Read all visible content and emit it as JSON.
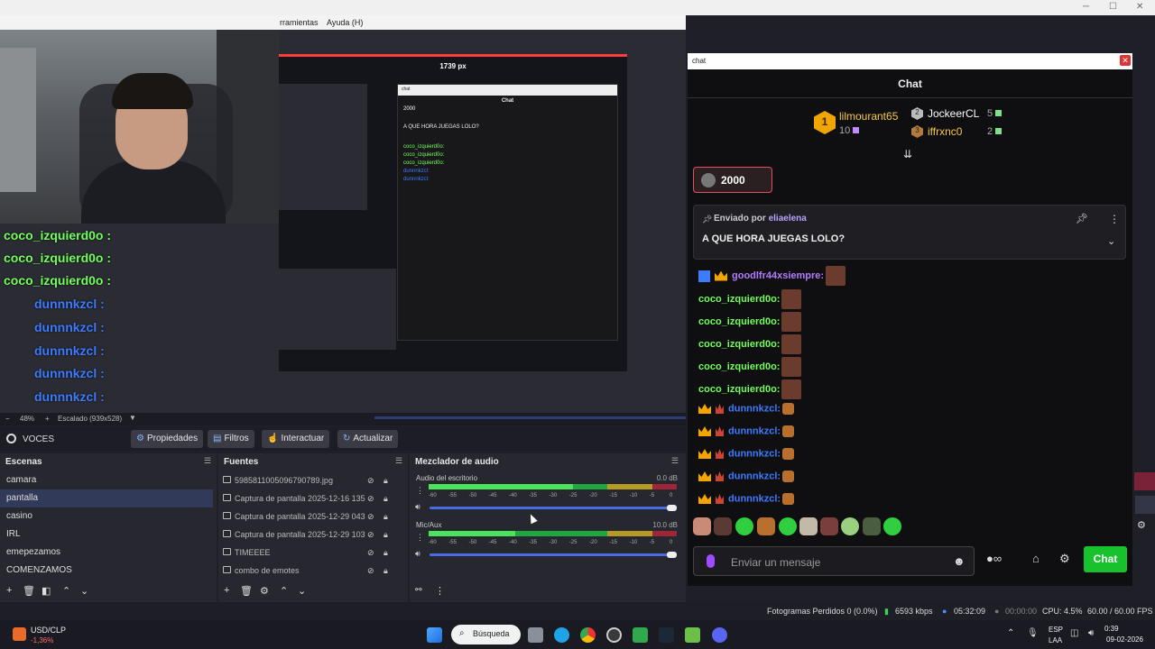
{
  "obs": {
    "menu": [
      {
        "label": "rramientas"
      },
      {
        "label": "Ayuda (H)"
      }
    ],
    "preview": {
      "capture_width_label": "1739 px",
      "zoom": "48%",
      "scale_label": "Escalado (939x528)"
    },
    "toolbar": {
      "scene_name": "VOCES",
      "buttons": [
        "Propiedades",
        "Filtros",
        "Interactuar",
        "Actualizar"
      ]
    },
    "scenes": {
      "title": "Escenas",
      "items": [
        "camara",
        "pantalla",
        "casino",
        "IRL",
        "emepezamos",
        "COMENZAMOS"
      ],
      "active": "pantalla"
    },
    "sources": {
      "title": "Fuentes",
      "items": [
        "5985811005096790789.jpg",
        "Captura de pantalla 2025-12-16 135",
        "Captura de pantalla 2025-12-29 043",
        "Captura de pantalla 2025-12-29 103",
        "TIMEEEE",
        "combo de emotes"
      ]
    },
    "mixer": {
      "title": "Mezclador de audio",
      "channels": [
        {
          "name": "Audio del escritorio",
          "db": "0.0 dB",
          "level": 0.58,
          "volume": 1.0
        },
        {
          "name": "Mic/Aux",
          "db": "10.0 dB",
          "level": 0.35,
          "volume": 1.0
        }
      ],
      "scale": [
        "-60",
        "-55",
        "-50",
        "-45",
        "-40",
        "-35",
        "-30",
        "-25",
        "-20",
        "-15",
        "-10",
        "-5",
        "0"
      ]
    },
    "status": {
      "dropped_frames": "Fotogramas Perdidos 0 (0.0%)",
      "bitrate": "6593 kbps",
      "stream_time": "05:32:09",
      "rec_time": "00:00:00",
      "cpu": "CPU: 4.5%",
      "fps": "60.00 / 60.00 FPS"
    }
  },
  "overlay": {
    "lines": [
      {
        "user": "coco_izquierd0o :",
        "color": "green"
      },
      {
        "user": "coco_izquierd0o :",
        "color": "green"
      },
      {
        "user": "coco_izquierd0o :",
        "color": "green"
      },
      {
        "user": "dunnnkzcl :",
        "color": "blue"
      },
      {
        "user": "dunnnkzcl :",
        "color": "blue"
      },
      {
        "user": "dunnnkzcl :",
        "color": "blue"
      },
      {
        "user": "dunnnkzcl :",
        "color": "blue"
      },
      {
        "user": "dunnnkzcl :",
        "color": "blue"
      }
    ]
  },
  "chat": {
    "window_title": "chat",
    "header": "Chat",
    "leaderboard": [
      {
        "rank": "1",
        "name": "lilmourant65",
        "count": "10",
        "color": "#f7c948"
      },
      {
        "rank": "2",
        "name": "JockeerCL",
        "count": "5",
        "color": "#ffffff"
      },
      {
        "rank": "3",
        "name": "iffrxnc0",
        "count": "2",
        "color": "#f7c948"
      }
    ],
    "viewers": "2000",
    "pinned": {
      "by_label": "Enviado por",
      "by_user": "eliaelena",
      "message": "A QUE HORA JUEGAS LOLO?"
    },
    "messages": [
      {
        "user": "goodlfr44xsiempre:",
        "color": "#b57bff"
      },
      {
        "user": "coco_izquierd0o:",
        "color": "#73ff5c"
      },
      {
        "user": "coco_izquierd0o:",
        "color": "#73ff5c"
      },
      {
        "user": "coco_izquierd0o:",
        "color": "#73ff5c"
      },
      {
        "user": "coco_izquierd0o:",
        "color": "#73ff5c"
      },
      {
        "user": "coco_izquierd0o:",
        "color": "#73ff5c"
      },
      {
        "user": "dunnnkzcl:",
        "color": "#3d7bff"
      },
      {
        "user": "dunnnkzcl:",
        "color": "#3d7bff"
      },
      {
        "user": "dunnnkzcl:",
        "color": "#3d7bff"
      },
      {
        "user": "dunnnkzcl:",
        "color": "#3d7bff"
      },
      {
        "user": "dunnnkzcl:",
        "color": "#3d7bff"
      }
    ],
    "input_placeholder": "Enviar un mensaje",
    "send_label": "Chat"
  },
  "taskbar": {
    "ticker_name": "USD/CLP",
    "ticker_change": "-1,36%",
    "search_label": "Búsqueda",
    "lang": "ESP",
    "lang_sub": "LAA",
    "time": "0:39",
    "date": "09-02-2026"
  }
}
